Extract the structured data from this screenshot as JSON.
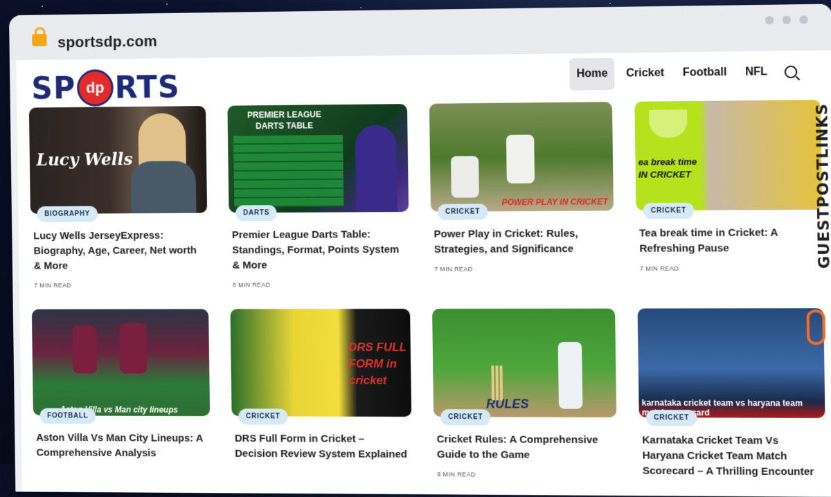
{
  "browser": {
    "url": "sportsdp.com"
  },
  "site": {
    "logo": {
      "left": "SP",
      "mark": "dp",
      "right": "RTS"
    },
    "nav": [
      "Home",
      "Cricket",
      "Football",
      "NFL"
    ]
  },
  "watermark": "GUESTPOSTLINKS",
  "cards": [
    {
      "category": "BIOGRAPHY",
      "title": "Lucy Wells JerseyExpress: Biography, Age, Career, Net worth & More",
      "read": "7 MIN READ",
      "overlay": "Lucy Wells"
    },
    {
      "category": "DARTS",
      "title": "Premier League Darts Table: Standings, Format, Points System & More",
      "read": "6 MIN READ",
      "overlay": "PREMIER LEAGUE DARTS TABLE"
    },
    {
      "category": "CRICKET",
      "title": "Power Play in Cricket: Rules, Strategies, and Significance",
      "read": "7 MIN READ",
      "overlay": "POWER PLAY IN CRICKET"
    },
    {
      "category": "CRICKET",
      "title": "Tea break time in Cricket: A Refreshing Pause",
      "read": "7 MIN READ",
      "overlay": "ea break time IN CRICKET"
    },
    {
      "category": "FOOTBALL",
      "title": "Aston Villa Vs Man City Lineups: A Comprehensive Analysis",
      "read": "",
      "overlay": "Aston Villa vs Man city lineups"
    },
    {
      "category": "CRICKET",
      "title": "DRS Full Form in Cricket – Decision Review System Explained",
      "read": "",
      "overlay": "DRS FULL FORM in cricket"
    },
    {
      "category": "CRICKET",
      "title": "Cricket Rules: A Comprehensive Guide to the Game",
      "read": "9 MIN READ",
      "overlay": "RULES"
    },
    {
      "category": "CRICKET",
      "title": "Karnataka Cricket Team Vs Haryana Cricket Team Match Scorecard – A Thrilling Encounter",
      "read": "",
      "overlay": "karnataka cricket team vs haryana team match scorecard"
    }
  ]
}
